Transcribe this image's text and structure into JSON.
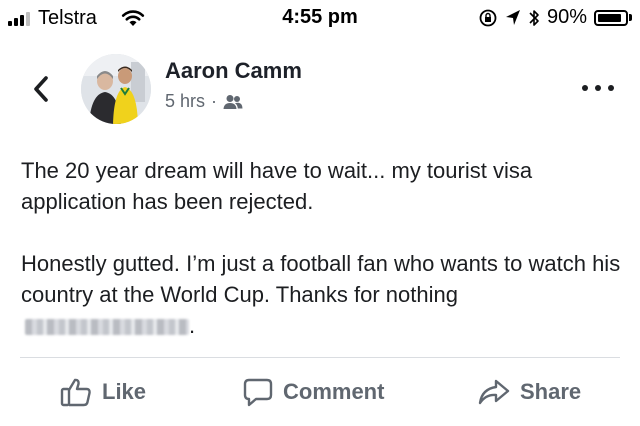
{
  "status_bar": {
    "carrier": "Telstra",
    "time": "4:55 pm",
    "battery": "90%",
    "battery_level": 0.9,
    "icons": [
      "signal-icon",
      "wifi-icon",
      "orientation-lock-icon",
      "location-icon",
      "bluetooth-icon",
      "battery-icon"
    ]
  },
  "post": {
    "author": "Aaron Camm",
    "time_ago": "5 hrs",
    "separator": "·",
    "audience_icon": "friends-icon",
    "paragraph1": "The 20 year dream will have to wait... my tourist visa application has been rejected.",
    "paragraph2": "Honestly gutted. I’m just a football fan who wants to watch his country at the World Cup. Thanks for nothing",
    "paragraph2_end": "."
  },
  "actions": {
    "like": "Like",
    "comment": "Comment",
    "share": "Share"
  },
  "colors": {
    "text": "#1c1e21",
    "secondary": "#606770",
    "divider": "#dadde1"
  }
}
